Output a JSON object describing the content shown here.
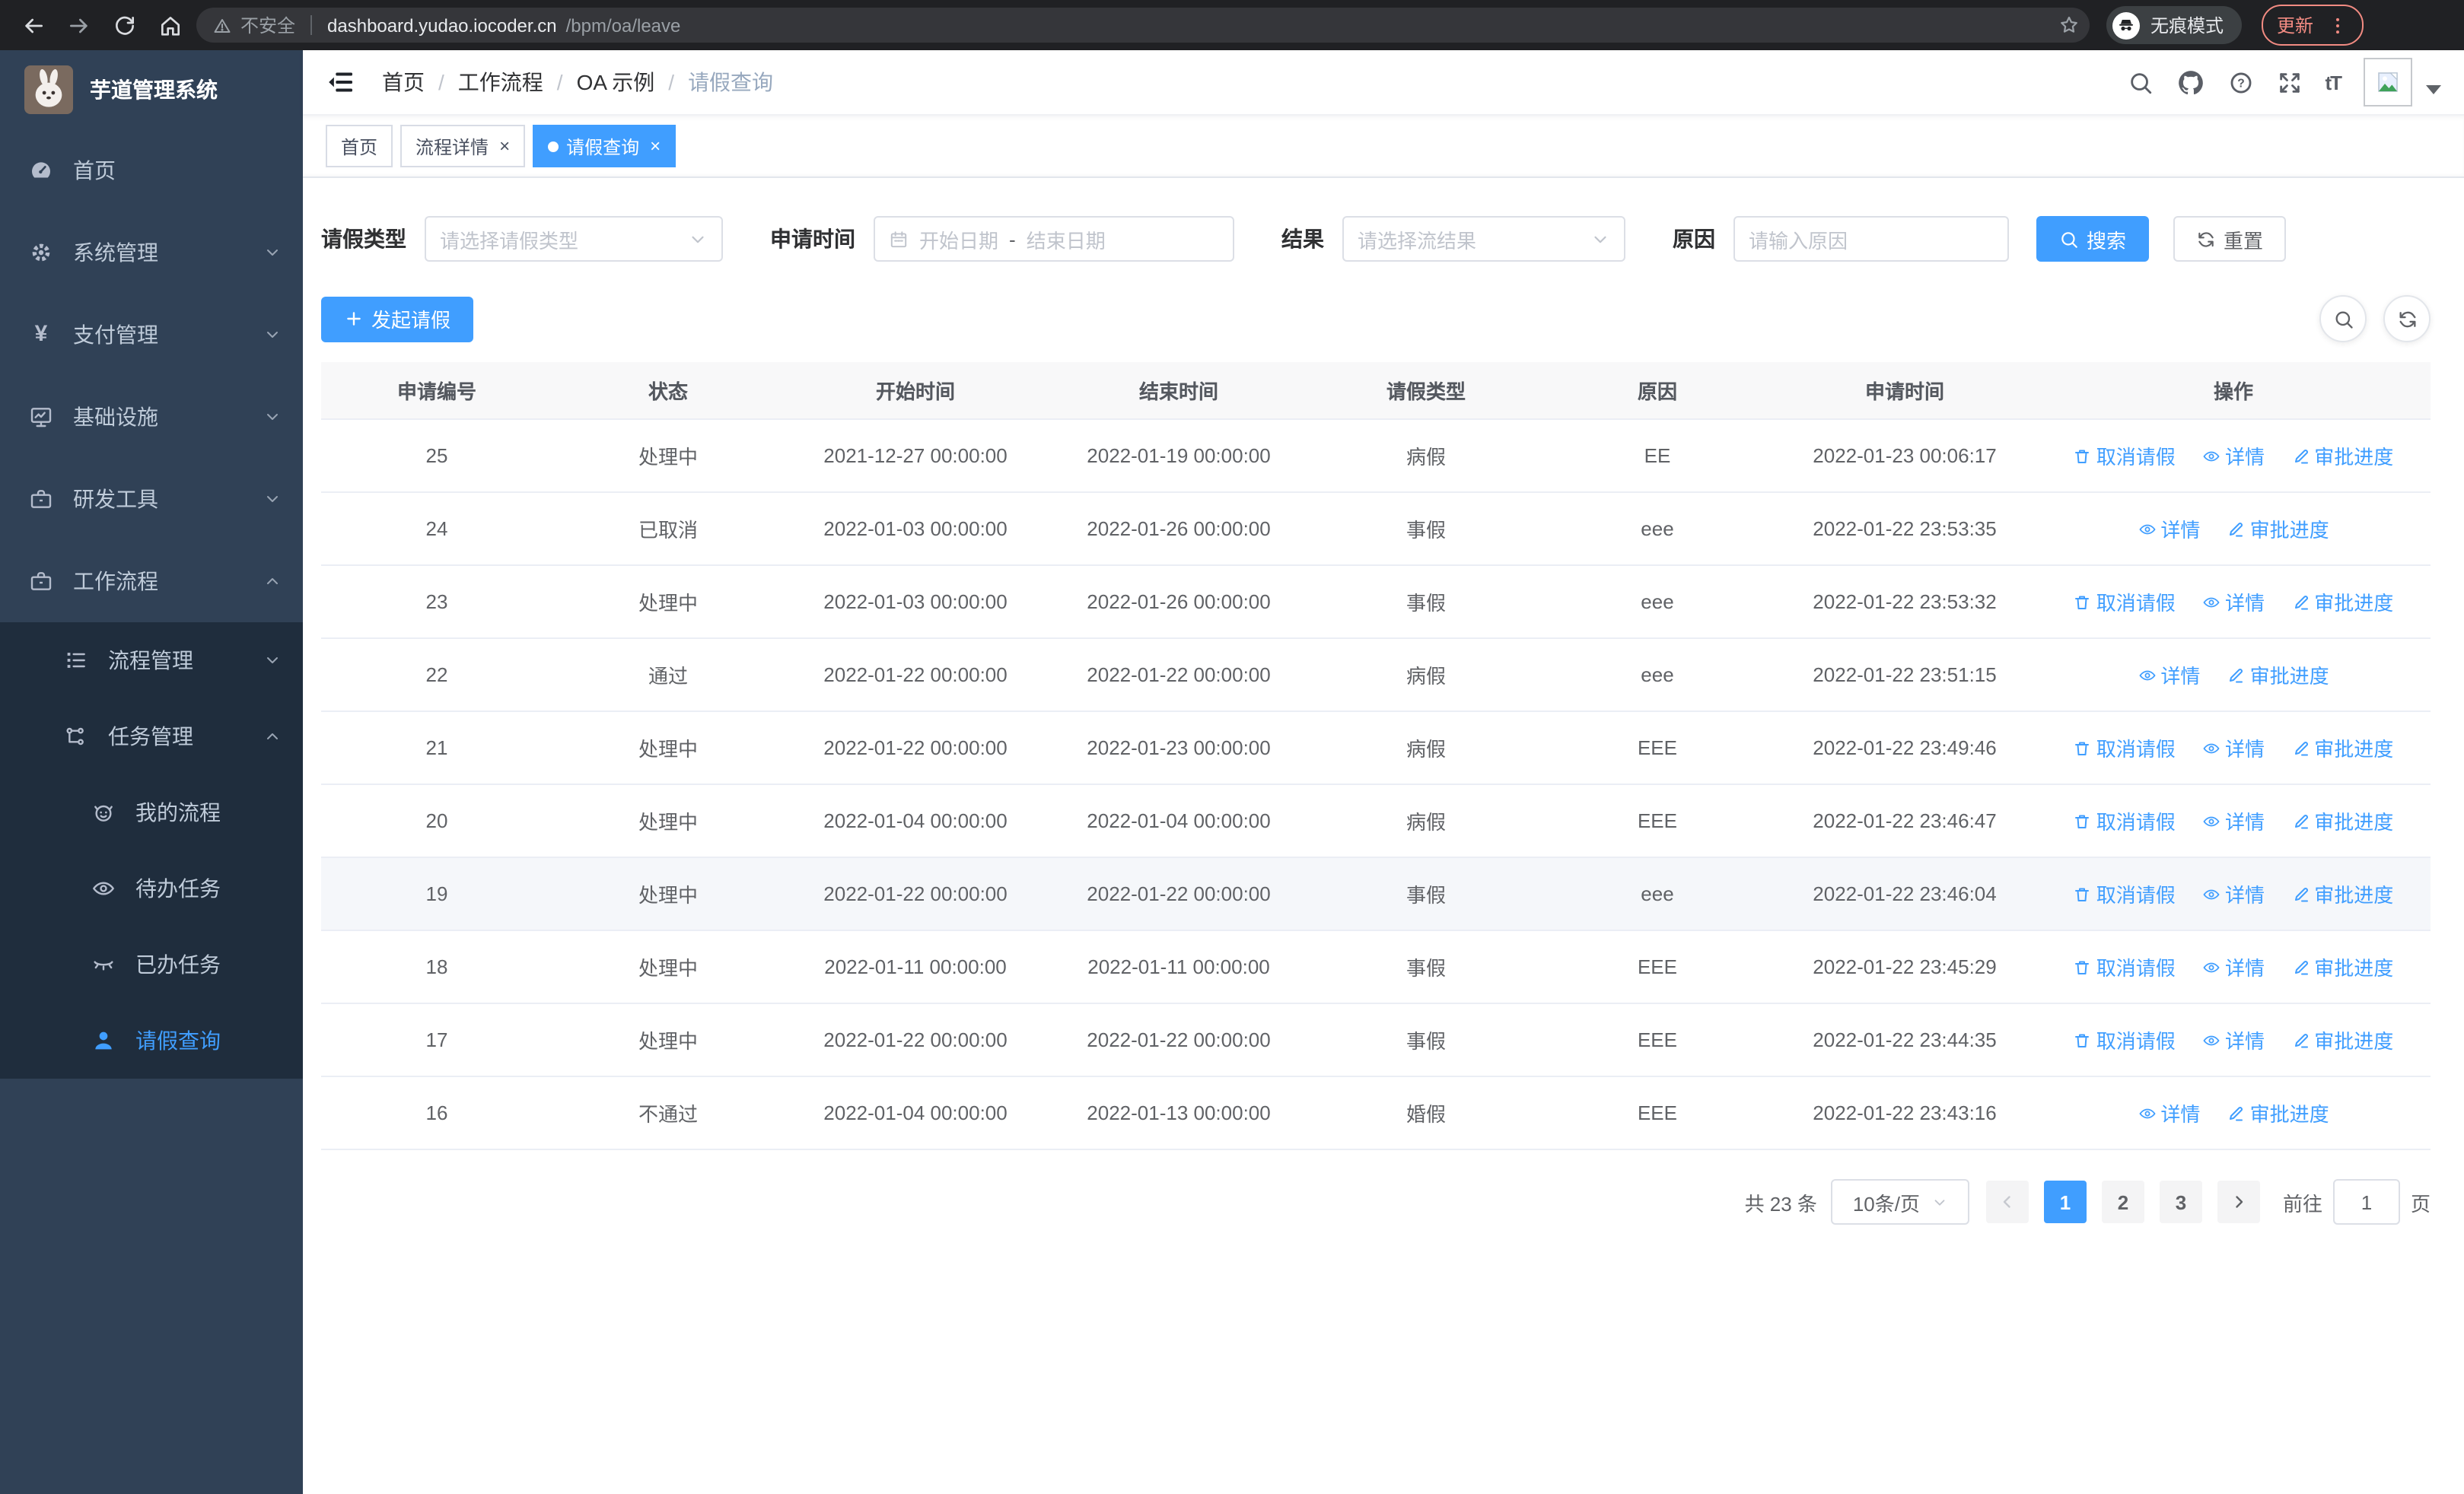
{
  "browser": {
    "security_label": "不安全",
    "url_host": "dashboard.yudao.iocoder.cn",
    "url_path": "/bpm/oa/leave",
    "incognito_label": "无痕模式",
    "update_label": "更新"
  },
  "sidebar": {
    "title": "芋道管理系统",
    "items": [
      {
        "label": "首页"
      },
      {
        "label": "系统管理"
      },
      {
        "label": "支付管理"
      },
      {
        "label": "基础设施"
      },
      {
        "label": "研发工具"
      },
      {
        "label": "工作流程"
      },
      {
        "label": "流程管理"
      },
      {
        "label": "任务管理"
      },
      {
        "label": "我的流程"
      },
      {
        "label": "待办任务"
      },
      {
        "label": "已办任务"
      },
      {
        "label": "请假查询"
      }
    ]
  },
  "header": {
    "breadcrumbs": [
      "首页",
      "工作流程",
      "OA 示例",
      "请假查询"
    ]
  },
  "tabs": [
    {
      "label": "首页"
    },
    {
      "label": "流程详情"
    },
    {
      "label": "请假查询"
    }
  ],
  "filters": {
    "leave_type_label": "请假类型",
    "leave_type_placeholder": "请选择请假类型",
    "apply_time_label": "申请时间",
    "start_date_placeholder": "开始日期",
    "range_separator": "-",
    "end_date_placeholder": "结束日期",
    "result_label": "结果",
    "result_placeholder": "请选择流结果",
    "reason_label": "原因",
    "reason_placeholder": "请输入原因",
    "search_label": "搜索",
    "reset_label": "重置"
  },
  "toolbar": {
    "create_label": "发起请假"
  },
  "table": {
    "columns": [
      "申请编号",
      "状态",
      "开始时间",
      "结束时间",
      "请假类型",
      "原因",
      "申请时间",
      "操作"
    ],
    "actions": {
      "cancel": "取消请假",
      "detail": "详情",
      "progress": "审批进度"
    },
    "rows": [
      {
        "id": "25",
        "status": "处理中",
        "start": "2021-12-27 00:00:00",
        "end": "2022-01-19 00:00:00",
        "type": "病假",
        "reason": "EE",
        "applied": "2022-01-23 00:06:17",
        "can_cancel": true,
        "highlighted": false
      },
      {
        "id": "24",
        "status": "已取消",
        "start": "2022-01-03 00:00:00",
        "end": "2022-01-26 00:00:00",
        "type": "事假",
        "reason": "eee",
        "applied": "2022-01-22 23:53:35",
        "can_cancel": false,
        "highlighted": false
      },
      {
        "id": "23",
        "status": "处理中",
        "start": "2022-01-03 00:00:00",
        "end": "2022-01-26 00:00:00",
        "type": "事假",
        "reason": "eee",
        "applied": "2022-01-22 23:53:32",
        "can_cancel": true,
        "highlighted": false
      },
      {
        "id": "22",
        "status": "通过",
        "start": "2022-01-22 00:00:00",
        "end": "2022-01-22 00:00:00",
        "type": "病假",
        "reason": "eee",
        "applied": "2022-01-22 23:51:15",
        "can_cancel": false,
        "highlighted": false
      },
      {
        "id": "21",
        "status": "处理中",
        "start": "2022-01-22 00:00:00",
        "end": "2022-01-23 00:00:00",
        "type": "病假",
        "reason": "EEE",
        "applied": "2022-01-22 23:49:46",
        "can_cancel": true,
        "highlighted": false
      },
      {
        "id": "20",
        "status": "处理中",
        "start": "2022-01-04 00:00:00",
        "end": "2022-01-04 00:00:00",
        "type": "病假",
        "reason": "EEE",
        "applied": "2022-01-22 23:46:47",
        "can_cancel": true,
        "highlighted": false
      },
      {
        "id": "19",
        "status": "处理中",
        "start": "2022-01-22 00:00:00",
        "end": "2022-01-22 00:00:00",
        "type": "事假",
        "reason": "eee",
        "applied": "2022-01-22 23:46:04",
        "can_cancel": true,
        "highlighted": true
      },
      {
        "id": "18",
        "status": "处理中",
        "start": "2022-01-11 00:00:00",
        "end": "2022-01-11 00:00:00",
        "type": "事假",
        "reason": "EEE",
        "applied": "2022-01-22 23:45:29",
        "can_cancel": true,
        "highlighted": false
      },
      {
        "id": "17",
        "status": "处理中",
        "start": "2022-01-22 00:00:00",
        "end": "2022-01-22 00:00:00",
        "type": "事假",
        "reason": "EEE",
        "applied": "2022-01-22 23:44:35",
        "can_cancel": true,
        "highlighted": false
      },
      {
        "id": "16",
        "status": "不通过",
        "start": "2022-01-04 00:00:00",
        "end": "2022-01-13 00:00:00",
        "type": "婚假",
        "reason": "EEE",
        "applied": "2022-01-22 23:43:16",
        "can_cancel": false,
        "highlighted": false
      }
    ]
  },
  "pagination": {
    "total_label": "共 23 条",
    "page_size_label": "10条/页",
    "pages": [
      "1",
      "2",
      "3"
    ],
    "active_page": "1",
    "goto_label": "前往",
    "goto_value": "1",
    "unit_label": "页"
  },
  "colors": {
    "accent_blue": "#409eff",
    "sidebar_bg": "#304156",
    "submenu_bg": "#1f2d3d",
    "link_blue": "#409eff",
    "update_pill": "#f28b82"
  },
  "icons": {
    "incognito": "spy-glasses",
    "update_menu": "vertical-dots",
    "table_actions": [
      "trash",
      "eye",
      "pencil"
    ]
  }
}
